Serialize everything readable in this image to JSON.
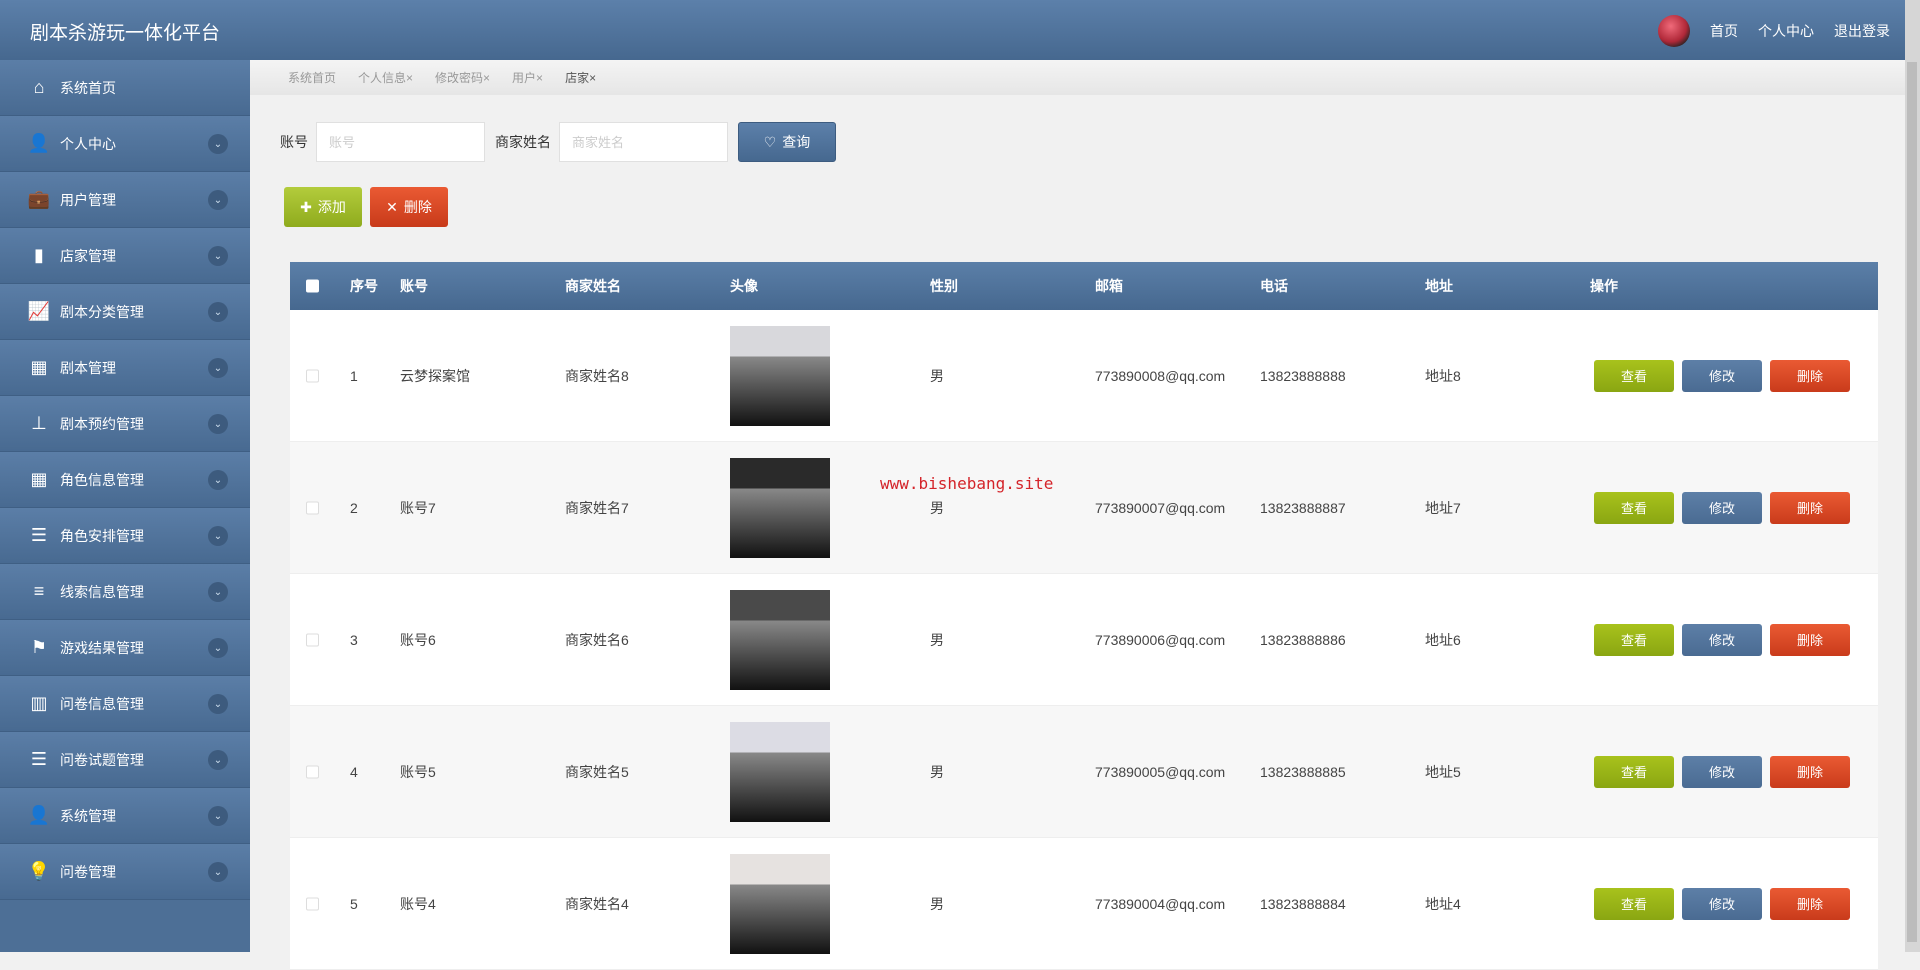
{
  "header": {
    "title": "剧本杀游玩一体化平台",
    "links": [
      "首页",
      "个人中心",
      "退出登录"
    ]
  },
  "sidebar": {
    "items": [
      {
        "label": "系统首页",
        "icon": "home-icon",
        "chev": false,
        "glyph": "⌂"
      },
      {
        "label": "个人中心",
        "icon": "user-icon",
        "chev": true,
        "glyph": "👤"
      },
      {
        "label": "用户管理",
        "icon": "briefcase-icon",
        "chev": true,
        "glyph": "💼"
      },
      {
        "label": "店家管理",
        "icon": "book-icon",
        "chev": true,
        "glyph": "▮"
      },
      {
        "label": "剧本分类管理",
        "icon": "chart-line-icon",
        "chev": true,
        "glyph": "📈"
      },
      {
        "label": "剧本管理",
        "icon": "grid-icon",
        "chev": true,
        "glyph": "▦"
      },
      {
        "label": "剧本预约管理",
        "icon": "stamp-icon",
        "chev": true,
        "glyph": "⊥"
      },
      {
        "label": "角色信息管理",
        "icon": "grid-icon",
        "chev": true,
        "glyph": "▦"
      },
      {
        "label": "角色安排管理",
        "icon": "indent-icon",
        "chev": true,
        "glyph": "☰"
      },
      {
        "label": "线索信息管理",
        "icon": "sliders-icon",
        "chev": true,
        "glyph": "≡"
      },
      {
        "label": "游戏结果管理",
        "icon": "flag-icon",
        "chev": true,
        "glyph": "⚑"
      },
      {
        "label": "问卷信息管理",
        "icon": "bar-chart-icon",
        "chev": true,
        "glyph": "▥"
      },
      {
        "label": "问卷试题管理",
        "icon": "list-icon",
        "chev": true,
        "glyph": "☰"
      },
      {
        "label": "系统管理",
        "icon": "user-icon",
        "chev": true,
        "glyph": "👤"
      },
      {
        "label": "问卷管理",
        "icon": "lightbulb-icon",
        "chev": true,
        "glyph": "💡"
      }
    ]
  },
  "tabs": [
    "系统首页",
    "个人信息×",
    "修改密码×",
    "用户×",
    "店家×"
  ],
  "search": {
    "account_label": "账号",
    "account_placeholder": "账号",
    "name_label": "商家姓名",
    "name_placeholder": "商家姓名",
    "query": "查询"
  },
  "actions": {
    "add": "添加",
    "delete": "删除"
  },
  "table": {
    "headers": [
      "序号",
      "账号",
      "商家姓名",
      "头像",
      "性别",
      "邮箱",
      "电话",
      "地址",
      "操作"
    ],
    "rows": [
      {
        "no": "1",
        "account": "云梦探案馆",
        "name": "商家姓名8",
        "gender": "男",
        "email": "773890008@qq.com",
        "phone": "13823888888",
        "address": "地址8",
        "photo": "#d8d8dc"
      },
      {
        "no": "2",
        "account": "账号7",
        "name": "商家姓名7",
        "gender": "男",
        "email": "773890007@qq.com",
        "phone": "13823888887",
        "address": "地址7",
        "photo": "#2a2a2a"
      },
      {
        "no": "3",
        "account": "账号6",
        "name": "商家姓名6",
        "gender": "男",
        "email": "773890006@qq.com",
        "phone": "13823888886",
        "address": "地址6",
        "photo": "#4a4a4a"
      },
      {
        "no": "4",
        "account": "账号5",
        "name": "商家姓名5",
        "gender": "男",
        "email": "773890005@qq.com",
        "phone": "13823888885",
        "address": "地址5",
        "photo": "#dcdce4"
      },
      {
        "no": "5",
        "account": "账号4",
        "name": "商家姓名4",
        "gender": "男",
        "email": "773890004@qq.com",
        "phone": "13823888884",
        "address": "地址4",
        "photo": "#e6e2e0"
      }
    ],
    "row_actions": {
      "view": "查看",
      "edit": "修改",
      "delete": "删除"
    }
  },
  "watermark": "www.bishebang.site"
}
